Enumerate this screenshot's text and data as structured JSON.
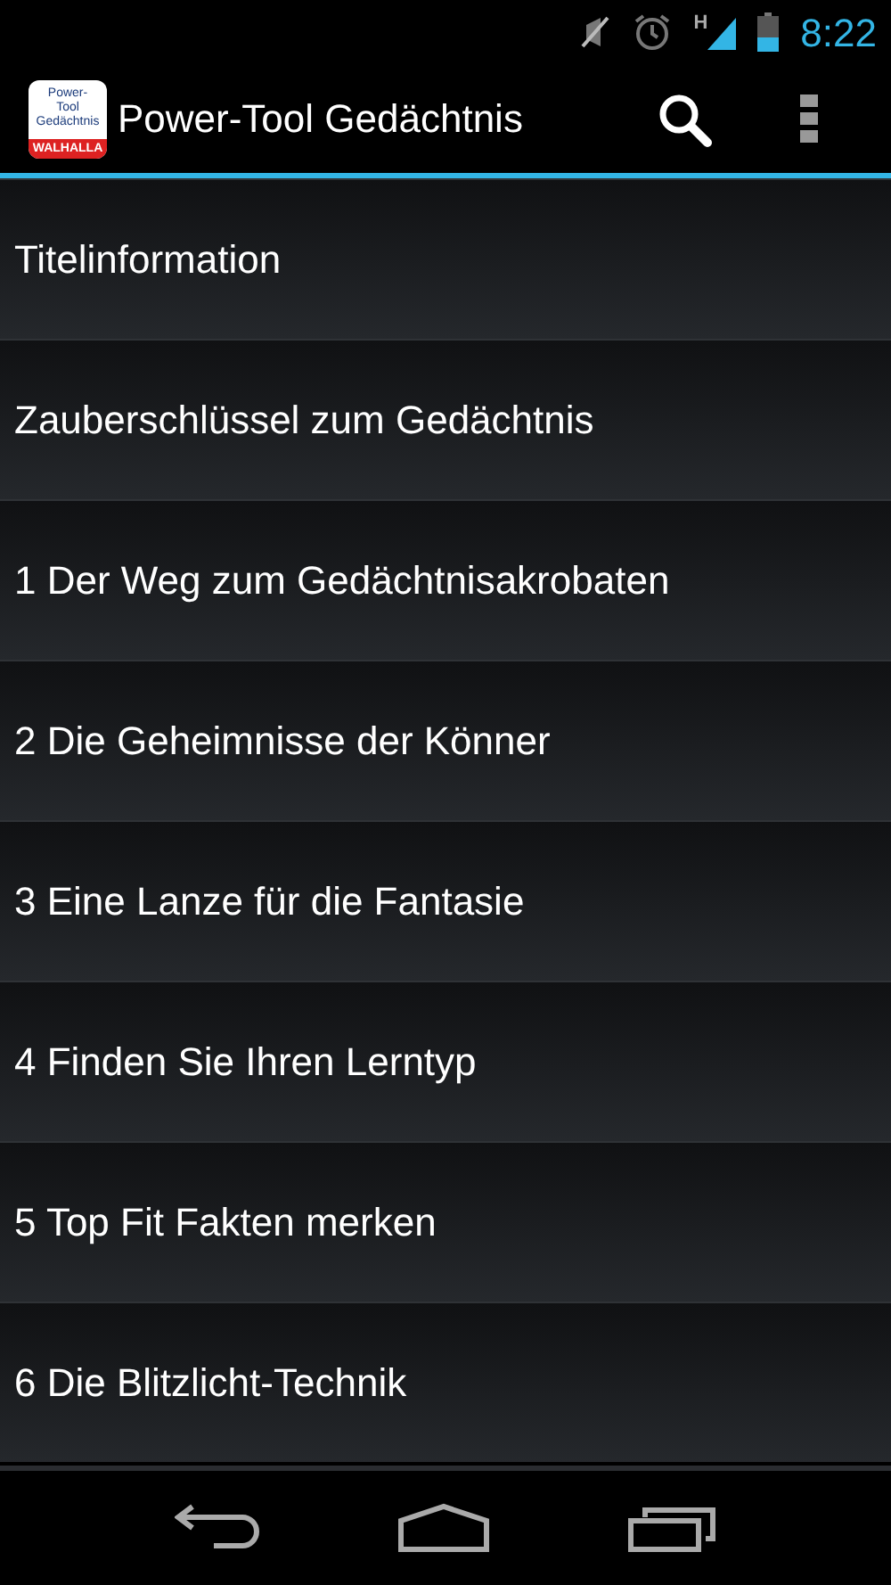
{
  "status_bar": {
    "time": "8:22",
    "network": "H"
  },
  "action_bar": {
    "logo": {
      "lines": [
        "Power-",
        "Tool",
        "Gedächtnis"
      ],
      "brand": "WALHALLA"
    },
    "title": "Power-Tool Gedächtnis"
  },
  "list": {
    "items": [
      {
        "label": "Titelinformation"
      },
      {
        "label": "Zauberschlüssel zum Gedächtnis"
      },
      {
        "label": "1 Der Weg zum Gedächtnisakrobaten"
      },
      {
        "label": "2 Die Geheimnisse der Könner"
      },
      {
        "label": "3 Eine Lanze für die Fantasie"
      },
      {
        "label": "4 Finden Sie Ihren Lerntyp"
      },
      {
        "label": "5 Top Fit Fakten merken"
      },
      {
        "label": "6 Die Blitzlicht-Technik"
      }
    ]
  }
}
